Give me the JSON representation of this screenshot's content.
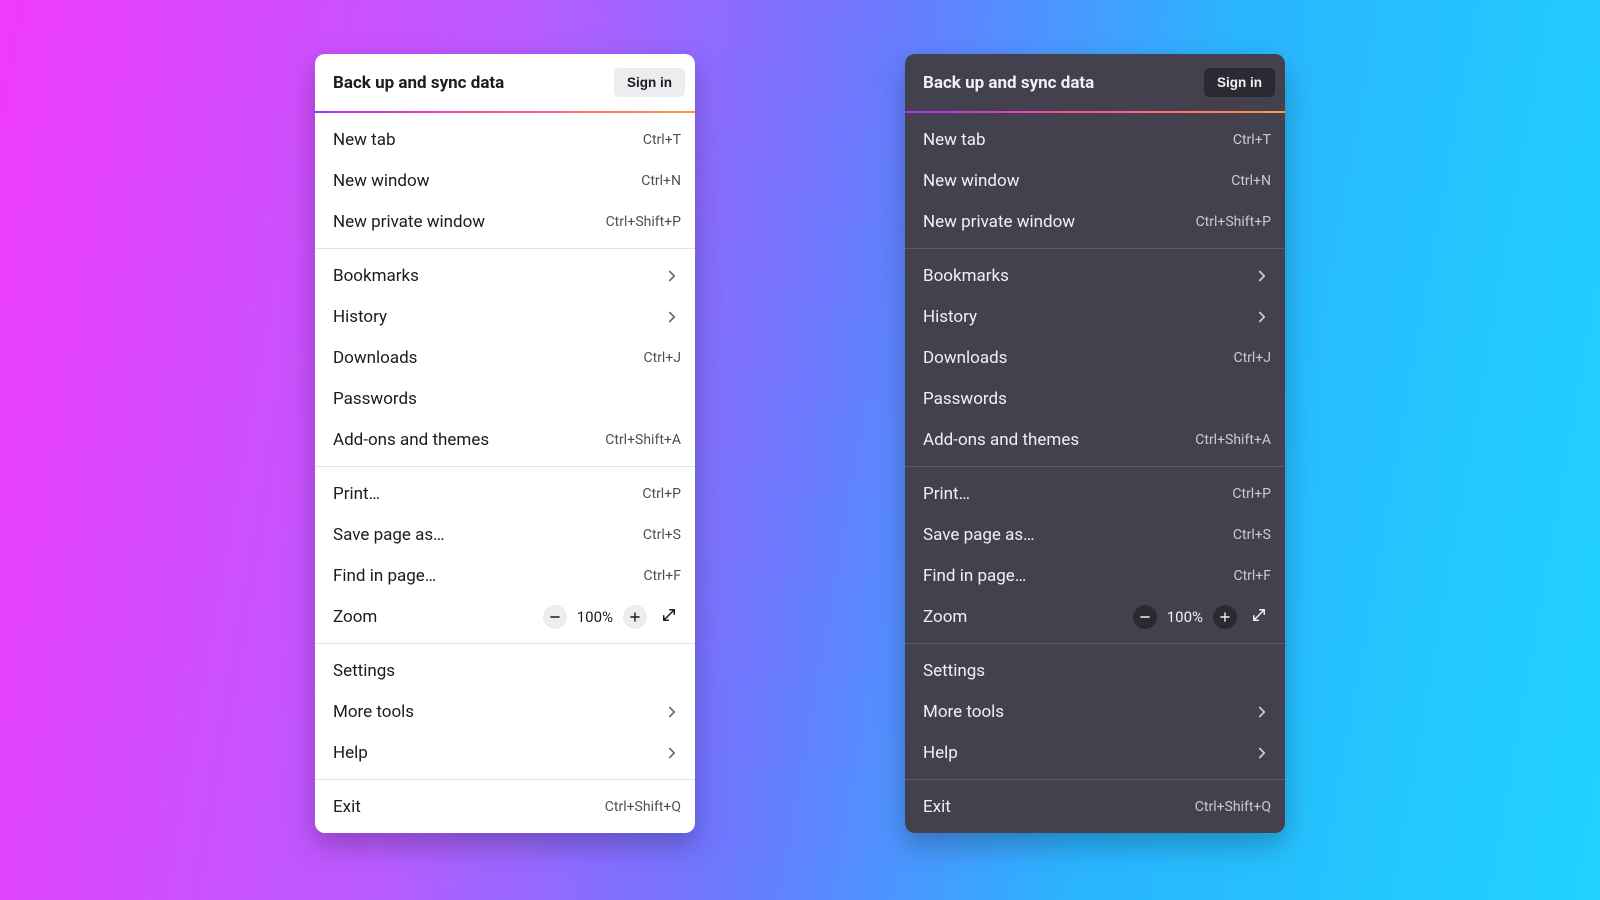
{
  "sync": {
    "title": "Back up and sync data",
    "signin_label": "Sign in"
  },
  "zoom_label": "Zoom",
  "zoom_level": "100%",
  "groups": [
    {
      "items": [
        {
          "id": "new-tab",
          "label": "New tab",
          "shortcut": "Ctrl+T"
        },
        {
          "id": "new-window",
          "label": "New window",
          "shortcut": "Ctrl+N"
        },
        {
          "id": "new-private-window",
          "label": "New private window",
          "shortcut": "Ctrl+Shift+P"
        }
      ]
    },
    {
      "items": [
        {
          "id": "bookmarks",
          "label": "Bookmarks",
          "submenu": true
        },
        {
          "id": "history",
          "label": "History",
          "submenu": true
        },
        {
          "id": "downloads",
          "label": "Downloads",
          "shortcut": "Ctrl+J"
        },
        {
          "id": "passwords",
          "label": "Passwords"
        },
        {
          "id": "addons",
          "label": "Add-ons and themes",
          "shortcut": "Ctrl+Shift+A"
        }
      ]
    },
    {
      "items": [
        {
          "id": "print",
          "label": "Print…",
          "shortcut": "Ctrl+P"
        },
        {
          "id": "save-page-as",
          "label": "Save page as…",
          "shortcut": "Ctrl+S"
        },
        {
          "id": "find-in-page",
          "label": "Find in page…",
          "shortcut": "Ctrl+F"
        },
        {
          "id": "zoom",
          "zoom": true
        }
      ]
    },
    {
      "items": [
        {
          "id": "settings",
          "label": "Settings"
        },
        {
          "id": "more-tools",
          "label": "More tools",
          "submenu": true
        },
        {
          "id": "help",
          "label": "Help",
          "submenu": true
        }
      ]
    },
    {
      "items": [
        {
          "id": "exit",
          "label": "Exit",
          "shortcut": "Ctrl+Shift+Q"
        }
      ]
    }
  ]
}
